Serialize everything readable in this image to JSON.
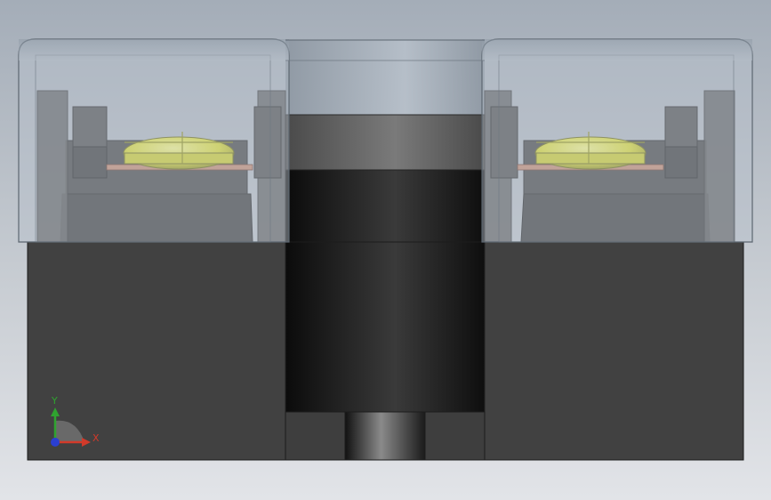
{
  "viewport": {
    "background_top": "#a4adb8",
    "background_bottom": "#e2e4e8"
  },
  "model": {
    "body_color": "#414141",
    "cover_color": "#a9b3be",
    "screw_color": "#e6e633",
    "contact_color": "#c88a70"
  },
  "triad": {
    "y_label": "Y",
    "x_label": "X",
    "y_color": "#2fa32f",
    "x_color": "#d23a2a",
    "z_color": "#2a3fd2"
  }
}
